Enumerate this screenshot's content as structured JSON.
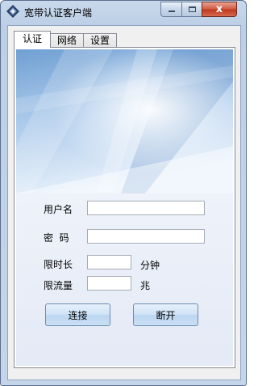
{
  "window": {
    "title": "宽带认证客户端",
    "controls": {
      "close": "x"
    }
  },
  "tabs": [
    {
      "label": "认证",
      "active": true
    },
    {
      "label": "网络",
      "active": false
    },
    {
      "label": "设置",
      "active": false
    }
  ],
  "login_form": {
    "username_label": "用户名",
    "username_value": "",
    "password_label": "密  码",
    "password_value": "",
    "time_limit_label": "限时长",
    "time_limit_value": "",
    "time_limit_unit": "分钟",
    "traffic_limit_label": "限流量",
    "traffic_limit_value": "",
    "traffic_limit_unit": "兆"
  },
  "actions": {
    "connect_label": "连接",
    "disconnect_label": "断开"
  },
  "colors": {
    "frame_blue": "#bccfe6",
    "panel_bg": "#ffffff",
    "close_red": "#c1391f",
    "banner_sky": "#8fb6de"
  },
  "icons": {
    "app": "diamond-logo-icon",
    "minimize": "minimize-icon",
    "maximize": "maximize-icon",
    "close": "close-icon"
  }
}
